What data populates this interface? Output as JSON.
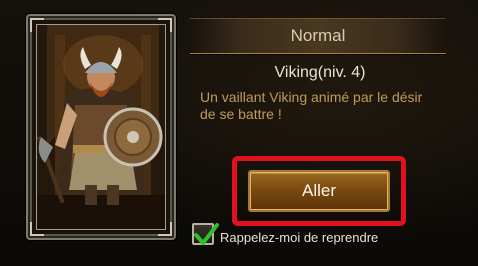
{
  "header": {
    "title": "Normal"
  },
  "hero": {
    "name": "Viking(niv. 4)",
    "description": "Un vaillant Viking animé par le désir de se battre !",
    "card_art": "viking-warrior-with-shield"
  },
  "actions": {
    "go_label": "Aller",
    "highlight_color": "#e0121b"
  },
  "reminder": {
    "label": "Rappelez-moi de reprendre",
    "checked": true,
    "check_color": "#2fbf2a"
  }
}
